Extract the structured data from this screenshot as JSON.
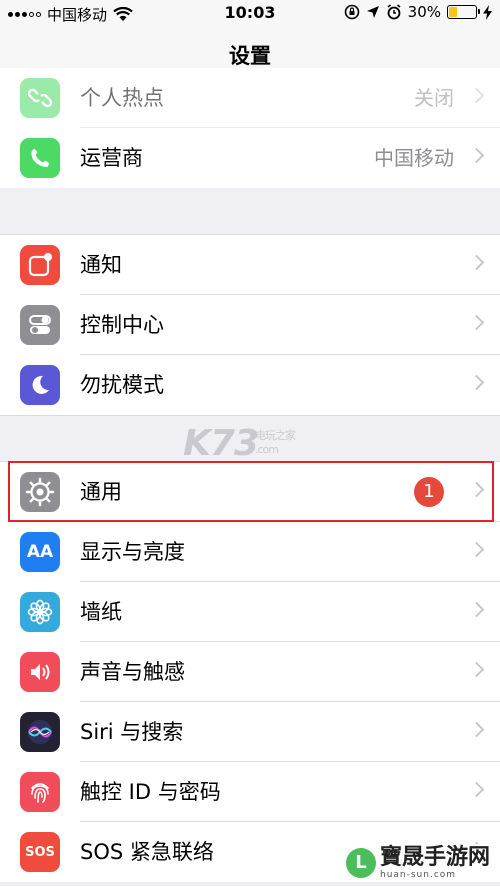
{
  "status": {
    "carrier": "中国移动",
    "time": "10:03",
    "battery": "30%",
    "battery_level": 0.3
  },
  "nav": {
    "title": "设置"
  },
  "group1": [
    {
      "label": "个人热点",
      "value": "关闭",
      "icon": "link-icon",
      "color": "#4cd964"
    },
    {
      "label": "运营商",
      "value": "中国移动",
      "icon": "phone-icon",
      "color": "#4cd964"
    }
  ],
  "group2": [
    {
      "label": "通知",
      "icon": "notifications-icon",
      "color": "#f04c3e"
    },
    {
      "label": "控制中心",
      "icon": "control-center-icon",
      "color": "#8e8e93"
    },
    {
      "label": "勿扰模式",
      "icon": "moon-icon",
      "color": "#5b58d6"
    }
  ],
  "group3": [
    {
      "label": "通用",
      "badge": "1",
      "icon": "gear-icon",
      "color": "#8e8e93"
    },
    {
      "label": "显示与亮度",
      "icon": "display-icon",
      "color": "#1f7ef2"
    },
    {
      "label": "墙纸",
      "icon": "flower-icon",
      "color": "#34aadc"
    },
    {
      "label": "声音与触感",
      "icon": "speaker-icon",
      "color": "#f04c5a"
    },
    {
      "label": "Siri 与搜索",
      "icon": "siri-icon",
      "color": "#222233"
    },
    {
      "label": "触控 ID 与密码",
      "icon": "fingerprint-icon",
      "color": "#f04c5a"
    },
    {
      "label": "SOS 紧急联络",
      "icon": "sos-icon",
      "color": "#f04c3e"
    }
  ],
  "watermarks": {
    "main": "K73",
    "sub": "电玩之家",
    "sub2": ".com",
    "footer": "寶晟手游网",
    "footer_url": "huan-sun.com"
  },
  "icon_text": {
    "aa": "AA",
    "sos": "SOS",
    "logo_letter": "L"
  }
}
